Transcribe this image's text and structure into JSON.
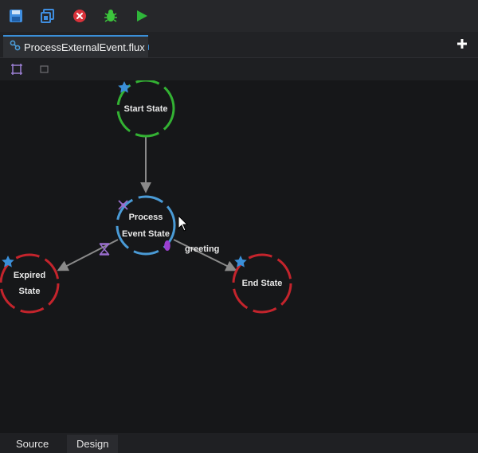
{
  "toolbar": {
    "buttons": [
      {
        "name": "save-icon",
        "color": "#3f8ee0"
      },
      {
        "name": "save-as-icon",
        "color": "#3f8ee0"
      },
      {
        "name": "stop-icon",
        "color": "#d9323a"
      },
      {
        "name": "debug-bug-icon",
        "color": "#3cc43c"
      },
      {
        "name": "run-play-icon",
        "color": "#2fb63a"
      }
    ]
  },
  "tabs": [
    {
      "label": "ProcessExternalEvent.flux",
      "modified": true
    }
  ],
  "diagram": {
    "states": [
      {
        "id": "start",
        "lines": [
          "Start State"
        ],
        "color": "#33b233",
        "starred": true
      },
      {
        "id": "process",
        "lines": [
          "Process",
          "Event State"
        ],
        "color": "#4a9bd6",
        "starred": false
      },
      {
        "id": "expired",
        "lines": [
          "Expired",
          "State"
        ],
        "color": "#c4242c",
        "starred": true
      },
      {
        "id": "end",
        "lines": [
          "End State"
        ],
        "color": "#c4242c",
        "starred": true
      }
    ],
    "transitions": [
      {
        "from": "start",
        "to": "process",
        "label": ""
      },
      {
        "from": "process",
        "to": "expired",
        "label": ""
      },
      {
        "from": "process",
        "to": "end",
        "label": "greeting"
      }
    ],
    "colors": {
      "arrow": "#8a8a8a",
      "star": "#3a8fd8",
      "marker_purple": "#9b3fd0"
    }
  },
  "bottom_tabs": [
    {
      "label": "Source",
      "active": false
    },
    {
      "label": "Design",
      "active": true
    }
  ]
}
